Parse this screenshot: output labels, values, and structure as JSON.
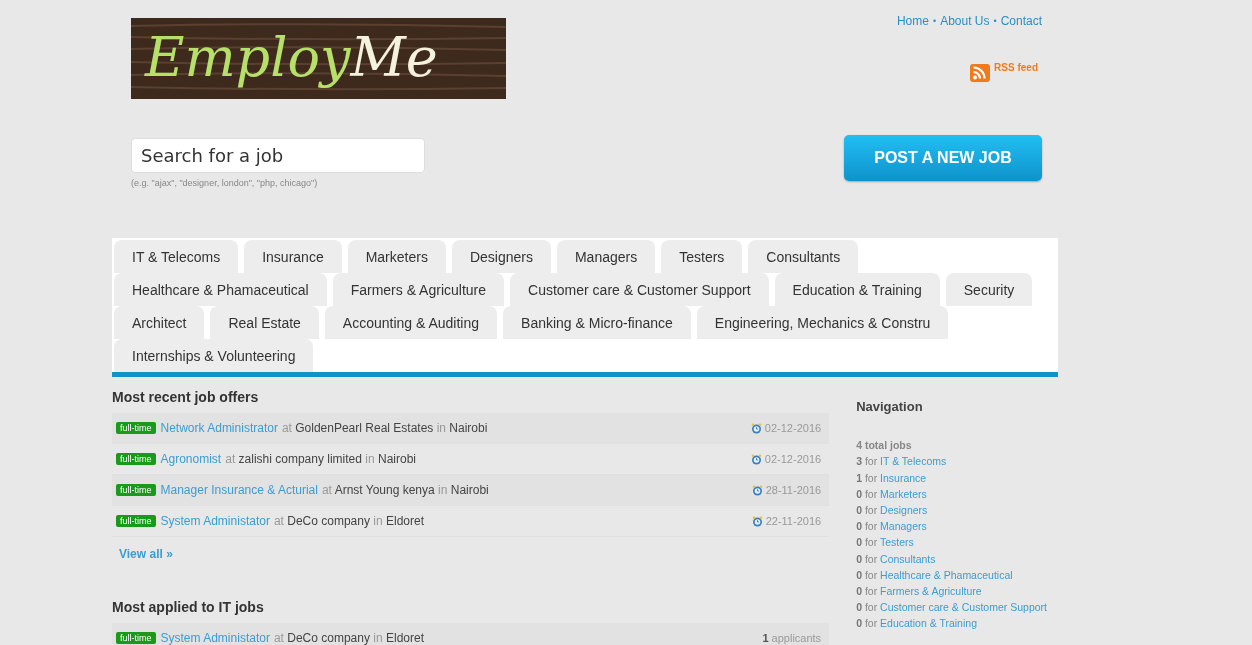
{
  "logo": {
    "first": "Employ",
    "second": "Me"
  },
  "top_links": [
    "Home",
    "About Us",
    "Contact"
  ],
  "separator": "•",
  "rss": {
    "label": "RSS feed"
  },
  "search": {
    "placeholder": "Search for a job",
    "hint": "(e.g. \"ajax\", \"designer, london\", \"php, chicago\")"
  },
  "post_button": "POST A NEW JOB",
  "tab_rows": [
    {
      "tabs": [
        "IT & Telecoms",
        "Insurance",
        "Marketers",
        "Designers",
        "Managers",
        "Testers",
        "Consultants"
      ]
    },
    {
      "tabs": [
        "Healthcare & Phamaceutical",
        "Farmers & Agriculture",
        "Customer care & Customer Support",
        "Education & Training",
        "Security"
      ]
    },
    {
      "tabs": [
        "Architect",
        "Real Estate",
        "Accounting & Auditing",
        "Banking & Micro-finance",
        "Engineering, Mechanics & Constru"
      ]
    },
    {
      "tabs": [
        "Internships & Volunteering"
      ]
    }
  ],
  "recent": {
    "title": "Most recent job offers",
    "jobs": [
      {
        "type": "full-time",
        "title": "Network Administrator",
        "at": "at",
        "company": "GoldenPearl Real Estates",
        "in": "in",
        "city": "Nairobi",
        "date": "02-12-2016"
      },
      {
        "type": "full-time",
        "title": "Agronomist",
        "at": "at",
        "company": "zalishi company limited",
        "in": "in",
        "city": "Nairobi",
        "date": "02-12-2016"
      },
      {
        "type": "full-time",
        "title": "Manager Insurance & Acturial",
        "at": "at",
        "company": "Arnst Young kenya",
        "in": "in",
        "city": "Nairobi",
        "date": "28-11-2016"
      },
      {
        "type": "full-time",
        "title": "System Administator",
        "at": "at",
        "company": "DeCo company",
        "in": "in",
        "city": "Eldoret",
        "date": "22-11-2016"
      }
    ],
    "view_all": "View all »"
  },
  "applied": {
    "title": "Most applied to IT jobs",
    "jobs": [
      {
        "type": "full-time",
        "title": "System Administator",
        "at": "at",
        "company": "DeCo company",
        "in": "in",
        "city": "Eldoret",
        "count": "1",
        "unit": "applicants"
      }
    ]
  },
  "navigation": {
    "title": "Navigation",
    "total": "4 total jobs",
    "items": [
      {
        "count": "3",
        "for": "for",
        "category": "IT & Telecoms"
      },
      {
        "count": "1",
        "for": "for",
        "category": "Insurance"
      },
      {
        "count": "0",
        "for": "for",
        "category": "Marketers"
      },
      {
        "count": "0",
        "for": "for",
        "category": "Designers"
      },
      {
        "count": "0",
        "for": "for",
        "category": "Managers"
      },
      {
        "count": "0",
        "for": "for",
        "category": "Testers"
      },
      {
        "count": "0",
        "for": "for",
        "category": "Consultants"
      },
      {
        "count": "0",
        "for": "for",
        "category": "Healthcare & Phamaceutical"
      },
      {
        "count": "0",
        "for": "for",
        "category": "Farmers & Agriculture"
      },
      {
        "count": "0",
        "for": "for",
        "category": "Customer care & Customer Support"
      },
      {
        "count": "0",
        "for": "for",
        "category": "Education & Training"
      }
    ]
  }
}
